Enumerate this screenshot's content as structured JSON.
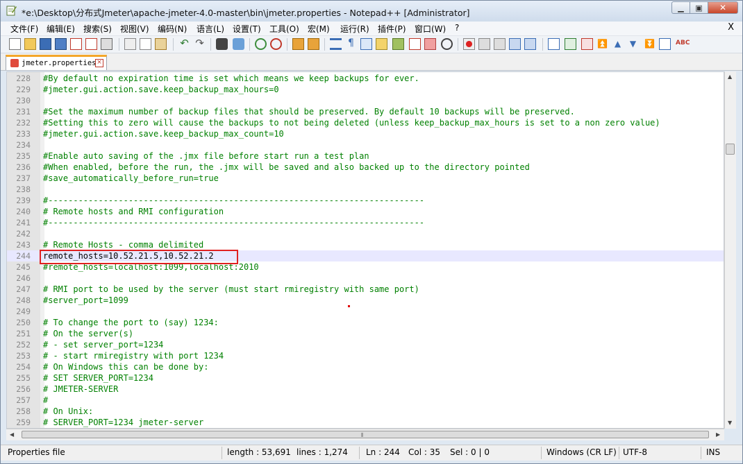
{
  "window": {
    "title": "*e:\\Desktop\\分布式Jmeter\\apache-jmeter-4.0-master\\bin\\jmeter.properties - Notepad++ [Administrator]",
    "minimize_glyph": "▁",
    "restore_glyph": "▣",
    "close_glyph": "✕"
  },
  "menu": {
    "items": [
      "文件(F)",
      "编辑(E)",
      "搜索(S)",
      "视图(V)",
      "编码(N)",
      "语言(L)",
      "设置(T)",
      "工具(O)",
      "宏(M)",
      "运行(R)",
      "插件(P)",
      "窗口(W)",
      "?"
    ],
    "close_doc": "X"
  },
  "tab": {
    "label": "jmeter.properties",
    "close_glyph": "×"
  },
  "editor": {
    "current_line": 244,
    "lines": [
      {
        "n": "228",
        "text": "#By default no expiration time is set which means we keep backups for ever."
      },
      {
        "n": "229",
        "text": "#jmeter.gui.action.save.keep_backup_max_hours=0"
      },
      {
        "n": "230",
        "text": ""
      },
      {
        "n": "231",
        "text": "#Set the maximum number of backup files that should be preserved. By default 10 backups will be preserved."
      },
      {
        "n": "232",
        "text": "#Setting this to zero will cause the backups to not being deleted (unless keep_backup_max_hours is set to a non zero value)"
      },
      {
        "n": "233",
        "text": "#jmeter.gui.action.save.keep_backup_max_count=10"
      },
      {
        "n": "234",
        "text": ""
      },
      {
        "n": "235",
        "text": "#Enable auto saving of the .jmx file before start run a test plan"
      },
      {
        "n": "236",
        "text": "#When enabled, before the run, the .jmx will be saved and also backed up to the directory pointed"
      },
      {
        "n": "237",
        "text": "#save_automatically_before_run=true"
      },
      {
        "n": "238",
        "text": ""
      },
      {
        "n": "239",
        "text": "#---------------------------------------------------------------------------"
      },
      {
        "n": "240",
        "text": "# Remote hosts and RMI configuration"
      },
      {
        "n": "241",
        "text": "#---------------------------------------------------------------------------"
      },
      {
        "n": "242",
        "text": ""
      },
      {
        "n": "243",
        "text": "# Remote Hosts - comma delimited"
      },
      {
        "n": "244",
        "text": "remote_hosts=10.52.21.5,10.52.21.2"
      },
      {
        "n": "245",
        "text": "#remote_hosts=localhost:1099,localhost:2010"
      },
      {
        "n": "246",
        "text": ""
      },
      {
        "n": "247",
        "text": "# RMI port to be used by the server (must start rmiregistry with same port)"
      },
      {
        "n": "248",
        "text": "#server_port=1099"
      },
      {
        "n": "249",
        "text": ""
      },
      {
        "n": "250",
        "text": "# To change the port to (say) 1234:"
      },
      {
        "n": "251",
        "text": "# On the server(s)"
      },
      {
        "n": "252",
        "text": "# - set server_port=1234"
      },
      {
        "n": "253",
        "text": "# - start rmiregistry with port 1234"
      },
      {
        "n": "254",
        "text": "# On Windows this can be done by:"
      },
      {
        "n": "255",
        "text": "# SET SERVER_PORT=1234"
      },
      {
        "n": "256",
        "text": "# JMETER-SERVER"
      },
      {
        "n": "257",
        "text": "#"
      },
      {
        "n": "258",
        "text": "# On Unix:"
      },
      {
        "n": "259",
        "text": "# SERVER_PORT=1234 jmeter-server"
      }
    ]
  },
  "status": {
    "file_type": "Properties file",
    "length": "length : 53,691",
    "lines": "lines : 1,274",
    "ln": "Ln : 244",
    "col": "Col : 35",
    "sel": "Sel : 0 | 0",
    "eol": "Windows (CR LF)",
    "encoding": "UTF-8",
    "mode": "INS"
  },
  "colors": {
    "comment": "#008000",
    "highlight_box": "#e02020",
    "current_line_bg": "#e8e8ff"
  }
}
